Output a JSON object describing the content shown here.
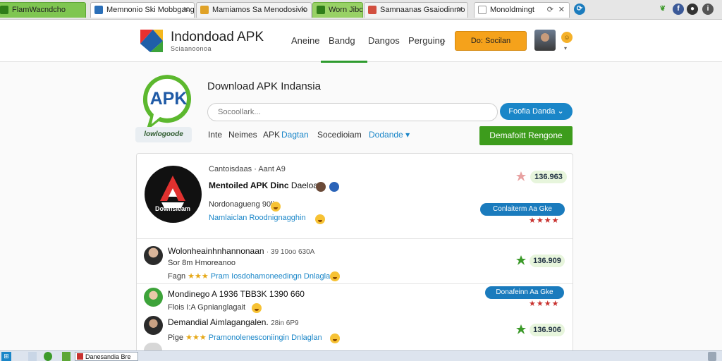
{
  "browser": {
    "tabs": [
      {
        "title": "FlamWacndcho"
      },
      {
        "title": "Memnonio Ski Mobbgang"
      },
      {
        "title": "Mamiamos Sa Menodosivio"
      },
      {
        "title": "Worn Jibo"
      },
      {
        "title": "Samnaanas Gsaiodinmo"
      },
      {
        "title": "Monoldmingt"
      }
    ]
  },
  "site": {
    "brand": "Indondoad APK",
    "tagline": "Sciaanoonoa",
    "nav": [
      "Aneine",
      "Bandg",
      "Dangos",
      "Perguing"
    ],
    "nav_more": "··",
    "cta": "Do: Socilan"
  },
  "hero": {
    "logo_text": "APK",
    "logo_caption": "lowlogoode",
    "title": "Download APK Indansia",
    "search_placeholder": "Socoollark...",
    "search_button": "Foofia Danda",
    "filters": [
      "Inte",
      "Neimes",
      "APK",
      "Dagtan",
      "Socedioiam",
      "Dodande"
    ],
    "action_button": "Demafoitt Rengone"
  },
  "featured": {
    "category": "Cantoisdaas · Aant A9",
    "logo_label": "Downsleam",
    "title_bold": "Mentoiled APK Dinc",
    "title_rest": "Daeloan",
    "description": "Nordonagueng 90lin",
    "link": "Namlaiclan Roodnignagghin",
    "rating": "136.963",
    "download_label": "Conlaiterm Aa Gke",
    "stars": "★★★★"
  },
  "rows": [
    {
      "title": "Wolonheainhnhannonaan",
      "meta": "· 39 10oo 630A",
      "sub": "Sor 8m Hmoreanoo",
      "prefix": "Fagn",
      "stars": "★★★",
      "link": "Pram Iosdohamoneedingn Dnlaglan",
      "rating": "136.909"
    },
    {
      "title": "Mondinego A 1936 TBB3K 1390 660",
      "sub": "Flois I:A Gpnianglagait",
      "download_label": "Donafeinn Aa Gke",
      "stars": "★★★★"
    },
    {
      "title": "Demandial Aimlagangalen.",
      "meta": "28in 6P9",
      "prefix": "Pige",
      "stars": "★★★",
      "link": "Pramonolenesconiingin Dnlaglan",
      "rating": "136.906"
    }
  ],
  "taskbar": {
    "active_item": "Danesandia Bre"
  }
}
